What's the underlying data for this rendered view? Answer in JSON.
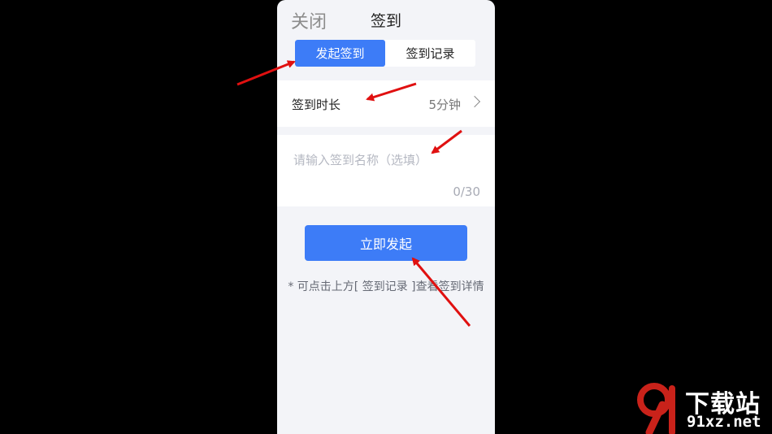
{
  "header": {
    "close_label": "关闭",
    "title": "签到"
  },
  "tabs": [
    {
      "label": "发起签到",
      "active": true
    },
    {
      "label": "签到记录",
      "active": false
    }
  ],
  "duration": {
    "label": "签到时长",
    "value": "5分钟"
  },
  "name_input": {
    "placeholder": "请输入签到名称（选填）",
    "value": "",
    "counter": "0/30"
  },
  "start_button": {
    "label": "立即发起"
  },
  "hint": "* 可点击上方[ 签到记录 ]查看签到详情",
  "watermark": {
    "logo_text": "91",
    "site_name": "下载站",
    "url": "91xz.net"
  },
  "colors": {
    "accent": "#3d7cf7",
    "arrow": "#e01010",
    "background": "#000000",
    "panel": "#f3f4f8"
  }
}
